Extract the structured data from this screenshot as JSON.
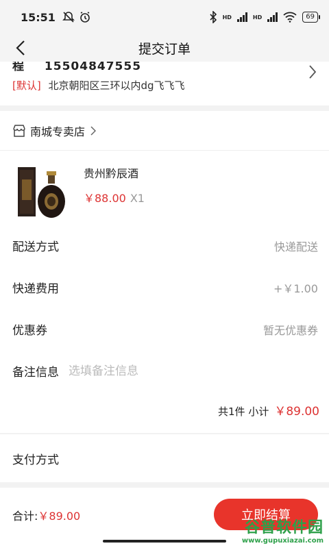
{
  "status": {
    "time": "15:51",
    "hd1": "HD",
    "hd2": "HD",
    "battery": "69"
  },
  "nav": {
    "title": "提交订单"
  },
  "address": {
    "name": "程",
    "phone": "15504847555",
    "default_tag": "[默认]",
    "detail": "北京朝阳区三环以内dg飞飞飞"
  },
  "store": {
    "name": "南城专卖店"
  },
  "product": {
    "name": "贵州黔辰酒",
    "price": "￥88.00",
    "qty": "X1"
  },
  "fields": {
    "delivery_label": "配送方式",
    "delivery_value": "快递配送",
    "shipping_label": "快递费用",
    "shipping_value": "+￥1.00",
    "coupon_label": "优惠券",
    "coupon_value": "暂无优惠券",
    "remark_label": "备注信息",
    "remark_placeholder": "选填备注信息"
  },
  "subtotal": {
    "label": "共1件 小计",
    "amount": "￥89.00"
  },
  "payment": {
    "label": "支付方式"
  },
  "bottom": {
    "total_label": "合计:",
    "total_amount": "￥89.00",
    "submit_label": "立即结算"
  },
  "watermark": {
    "title": "谷普软件园",
    "url": "www.gupuxiazai.com"
  },
  "colors": {
    "accent": "#e8342b",
    "price": "#d33333"
  }
}
